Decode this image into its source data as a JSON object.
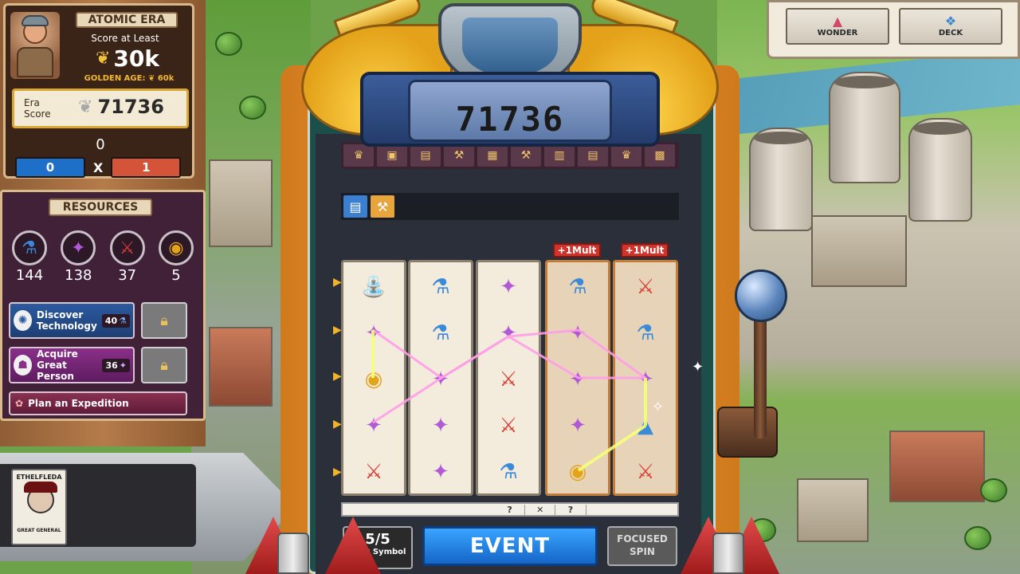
{
  "era": {
    "title": "ATOMIC ERA",
    "score_label": "Score at Least",
    "score_target": "30k",
    "golden_age_label": "GOLDEN AGE:",
    "golden_age_value": "60k",
    "era_score_label": "Era Score",
    "era_score_value": "71736",
    "zero_count": "0",
    "ratio_left": "0",
    "ratio_sep": "X",
    "ratio_right": "1"
  },
  "resources": {
    "title": "RESOURCES",
    "items": [
      {
        "icon": "flask-icon",
        "glyph": "⚗",
        "value": "144",
        "color": "#3b8ad8"
      },
      {
        "icon": "great-person-card-icon",
        "glyph": "✦",
        "value": "138",
        "color": "#b15ad6"
      },
      {
        "icon": "crossed-swords-icon",
        "glyph": "⚔",
        "value": "37",
        "color": "#d94038"
      },
      {
        "icon": "gold-coin-icon",
        "glyph": "◉",
        "value": "5",
        "color": "#e4a41a"
      }
    ]
  },
  "actions": {
    "discover_label": "Discover Technology",
    "discover_cost": "40",
    "acquire_label": "Acquire Great Person",
    "acquire_cost": "36",
    "expedition_label": "Plan an Expedition"
  },
  "general": {
    "name": "ETHELFLEDA",
    "role": "GREAT GENERAL"
  },
  "machine": {
    "score": "71736",
    "mult_badges": [
      "+1Mult",
      "+1Mult"
    ],
    "progress_marks": [
      "",
      "",
      "",
      "",
      "",
      "?",
      "✕",
      "?",
      "",
      "",
      ""
    ],
    "lock_count": "5/5",
    "lock_label": "Lock Symbol",
    "event_label": "EVENT",
    "focused_label": "FOCUSED SPIN"
  },
  "reels": [
    [
      "wonder-fountain",
      "card",
      "coin",
      "card",
      "swords"
    ],
    [
      "flask",
      "flask",
      "card",
      "card",
      "card"
    ],
    [
      "card",
      "card",
      "swords",
      "swords",
      "flask"
    ],
    [
      "flask",
      "card",
      "card",
      "card",
      "coin"
    ],
    [
      "swords",
      "flask",
      "card",
      "wonder",
      "swords"
    ]
  ],
  "top_buttons": {
    "wonder_label": "WONDER",
    "deck_label": "DECK"
  },
  "colors": {
    "accent_blue": "#1465c8",
    "accent_red": "#d0332a",
    "gold": "#f2c23a"
  }
}
